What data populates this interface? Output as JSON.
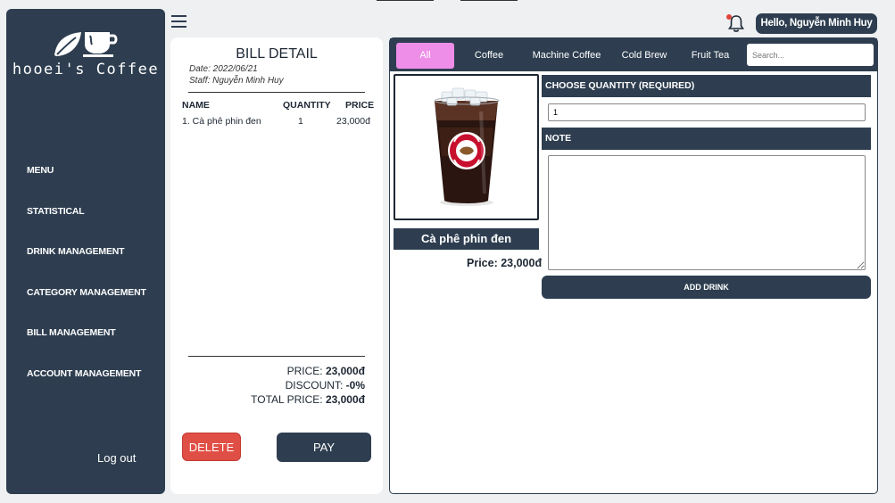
{
  "brand": {
    "name": "hooei's Coffee"
  },
  "sidebar": {
    "items": [
      {
        "label": "MENU"
      },
      {
        "label": "STATISTICAL"
      },
      {
        "label": "DRINK MANAGEMENT"
      },
      {
        "label": "CATEGORY MANAGEMENT"
      },
      {
        "label": "BILL MANAGEMENT"
      },
      {
        "label": "ACCOUNT MANAGEMENT"
      }
    ],
    "logout": "Log out"
  },
  "header": {
    "greeting": "Hello, Nguyễn Minh Huy",
    "notification_dot_color": "#e0453b"
  },
  "bill": {
    "title": "BILL DETAIL",
    "date": "Date: 2022/06/21",
    "staff": "Staff: Nguyễn Minh Huy",
    "columns": {
      "name": "NAME",
      "quantity": "QUANTITY",
      "price": "PRICE"
    },
    "items": [
      {
        "name": "1. Cà phê phin đen",
        "quantity": "1",
        "price": "23,000đ"
      }
    ],
    "totals": {
      "price_label": "PRICE: ",
      "price_value": "23,000đ",
      "discount_label": "DISCOUNT: ",
      "discount_value": "-0%",
      "total_label": "TOTAL PRICE: ",
      "total_value": "23,000đ"
    },
    "delete_label": "DELETE",
    "pay_label": "PAY"
  },
  "categories": {
    "tabs": [
      {
        "label": "All",
        "active": true
      },
      {
        "label": "Coffee"
      },
      {
        "label": "Machine Coffee"
      },
      {
        "label": "Cold Brew"
      },
      {
        "label": "Fruit Tea"
      }
    ],
    "search_placeholder": "Search..."
  },
  "product": {
    "name": "Cà phê phin đen",
    "price": "Price: 23,000đ",
    "image_icon": "iced-coffee-cup-icon"
  },
  "order_form": {
    "quantity_heading": "CHOOSE QUANTITY (REQUIRED)",
    "quantity_value": "1",
    "note_heading": "NOTE",
    "note_value": "",
    "add_label": "ADD DRINK"
  },
  "colors": {
    "primary": "#2e3e50",
    "active_tab": "#ee8ee8",
    "danger": "#e04f45",
    "background": "#eef0f2"
  }
}
